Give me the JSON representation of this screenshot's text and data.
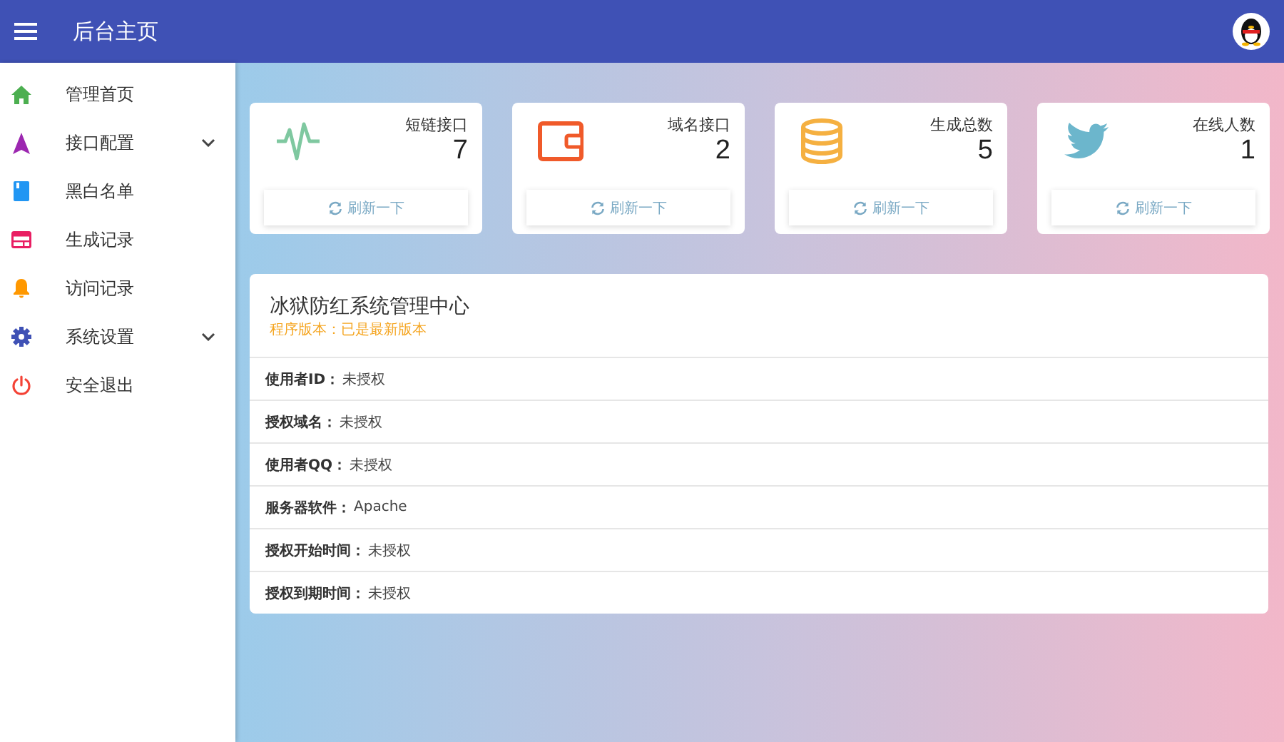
{
  "header": {
    "title": "后台主页"
  },
  "sidebar": {
    "items": [
      {
        "label": "管理首页",
        "kind": "home",
        "expandable": false
      },
      {
        "label": "接口配置",
        "kind": "navigation",
        "expandable": true
      },
      {
        "label": "黑白名单",
        "kind": "book",
        "expandable": false
      },
      {
        "label": "生成记录",
        "kind": "card",
        "expandable": false
      },
      {
        "label": "访问记录",
        "kind": "bell",
        "expandable": false
      },
      {
        "label": "系统设置",
        "kind": "gear",
        "expandable": true
      },
      {
        "label": "安全退出",
        "kind": "power",
        "expandable": false
      }
    ]
  },
  "stats": [
    {
      "label": "短链接口",
      "value": "7",
      "kind": "pulse",
      "button": "刷新一下"
    },
    {
      "label": "域名接口",
      "value": "2",
      "kind": "wallet",
      "button": "刷新一下"
    },
    {
      "label": "生成总数",
      "value": "5",
      "kind": "database",
      "button": "刷新一下"
    },
    {
      "label": "在线人数",
      "value": "1",
      "kind": "bird",
      "button": "刷新一下"
    }
  ],
  "info_panel": {
    "title": "冰狱防红系统管理中心",
    "subtitle": "程序版本：已是最新版本",
    "rows": [
      {
        "label": "使用者ID：",
        "value": "未授权"
      },
      {
        "label": "授权域名：",
        "value": "未授权"
      },
      {
        "label": "使用者QQ：",
        "value": "未授权"
      },
      {
        "label": "服务器软件：",
        "value": "Apache"
      },
      {
        "label": "授权开始时间：",
        "value": "未授权"
      },
      {
        "label": "授权到期时间：",
        "value": "未授权"
      }
    ]
  }
}
